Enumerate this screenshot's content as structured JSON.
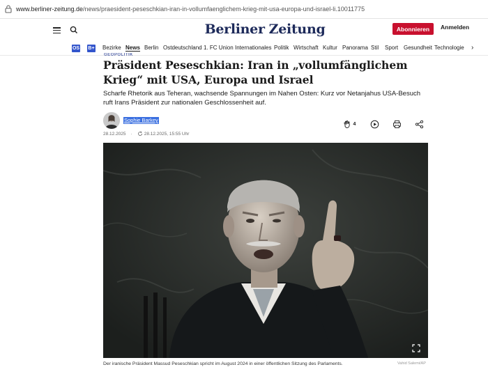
{
  "browser": {
    "url_host": "www.berliner-zeitung.de",
    "url_path": "/news/praesident-peseschkian-iran-in-vollumfaenglichem-krieg-mit-usa-europa-und-israel-li.10011775"
  },
  "header": {
    "logo_left": "Berliner",
    "logo_right": "Zeitung",
    "subscribe_label": "Abonnieren",
    "login_label": "Anmelden"
  },
  "nav": {
    "badges": [
      "OS",
      "B+"
    ],
    "items": [
      "Bezirke",
      "News",
      "Berlin",
      "Ostdeutschland",
      "1. FC Union",
      "Internationales",
      "Politik",
      "Wirtschaft",
      "Kultur",
      "Panorama",
      "Stil",
      "Sport",
      "Gesundheit",
      "Technologie"
    ],
    "active": "News"
  },
  "article": {
    "kicker": "GEOPOLITIK",
    "headline": "Präsident Peseschkian: Iran in „vollumfänglichem Krieg“ mit USA, Europa und Israel",
    "lead": "Scharfe Rhetorik aus Teheran, wachsende Spannungen im Nahen Osten: Kurz vor Netanjahus USA-Besuch ruft Irans Präsident zur nationalen Geschlossenheit auf.",
    "author": "Sophie Barkey",
    "date": "28.12.2025",
    "updated": "28.12.2025, 15:55 Uhr",
    "clap_count": "4",
    "caption": "Der iranische Präsident Massud Peseschkian spricht im August 2024 in einer öffentlichen Sitzung des Parlaments.",
    "credit": "Vahid Salemi/AP"
  },
  "icons": {
    "lock": "lock-icon",
    "menu": "hamburger-menu-icon",
    "search": "search-icon",
    "clap": "clap-icon",
    "play": "play-icon",
    "print": "print-icon",
    "share": "share-icon",
    "expand": "fullscreen-icon",
    "chevron": "chevron-right-icon"
  },
  "colors": {
    "brand": "#1d2a5a",
    "subscribe_bg": "#c8102e",
    "badge_bg": "#3355cc",
    "author_highlight": "#3a6fe0"
  }
}
